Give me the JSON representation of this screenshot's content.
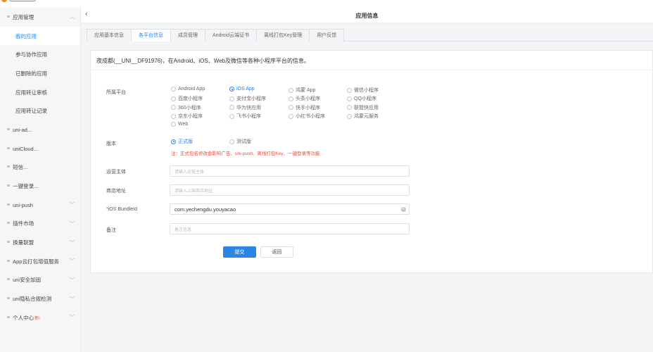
{
  "header": {
    "title": "应用信息"
  },
  "sidebar": {
    "items": [
      {
        "label": "应用管理",
        "type": "group",
        "chevron": "up"
      },
      {
        "label": "我的应用",
        "type": "sub",
        "active": true
      },
      {
        "label": "参与协作应用",
        "type": "sub"
      },
      {
        "label": "已删除的应用",
        "type": "sub"
      },
      {
        "label": "应用转让审核",
        "type": "sub"
      },
      {
        "label": "应用转让记录",
        "type": "sub"
      },
      {
        "label": "uni-ad...",
        "type": "group"
      },
      {
        "label": "uniCloud...",
        "type": "group"
      },
      {
        "label": "短信...",
        "type": "group"
      },
      {
        "label": "一键登录...",
        "type": "group"
      },
      {
        "label": "uni-push",
        "type": "group",
        "chevron": "down"
      },
      {
        "label": "插件市场",
        "type": "group",
        "chevron": "down"
      },
      {
        "label": "换量联盟",
        "type": "group",
        "chevron": "down"
      },
      {
        "label": "App云打包增值服务",
        "type": "group",
        "chevron": "down"
      },
      {
        "label": "uni安全加固",
        "type": "group",
        "chevron": "down"
      },
      {
        "label": "uni隐私合规检测",
        "type": "group",
        "chevron": "down"
      },
      {
        "label": "个人中心",
        "type": "group",
        "chevron": "down",
        "badge": "新!"
      }
    ]
  },
  "tabs": [
    "应用基本信息",
    "各平台信息",
    "成员管理",
    "Android云端证书",
    "离线打包Key管理",
    "用户反馈"
  ],
  "active_tab": "各平台信息",
  "form": {
    "description": "夜成都(__UNI__DF91976)，在Android、iOS、Web及微信等各种小程序平台的信息。",
    "platform_label": "所属平台",
    "platforms": [
      "Android App",
      "iOS App",
      "鸿蒙 App",
      "微信小程序",
      "百度小程序",
      "支付宝小程序",
      "头条小程序",
      "QQ小程序",
      "360小程序",
      "华为快应用",
      "快手小程序",
      "联盟快应用",
      "京东小程序",
      "飞书小程序",
      "小红书小程序",
      "鸿蒙元服务",
      "Web"
    ],
    "selected_platform": "iOS App",
    "version_label": "版本",
    "versions": [
      "正式版",
      "测试版"
    ],
    "selected_version": "正式版",
    "version_warning": "注：正式包名修改会影响广告、uni-push、离线打包Key、一键登录等功能",
    "operator_label": "运营主体",
    "operator_placeholder": "请输入运营主体",
    "store_label": "商店地址",
    "store_placeholder": "请输入上架商店地址",
    "bundle_label": "iOS BundleId",
    "bundle_required_mark": "*",
    "bundle_value": "com.yechengdu.youyacao",
    "remark_label": "备注",
    "remark_placeholder": "备注信息",
    "submit_label": "提交",
    "back_label": "返回"
  },
  "colors": {
    "accent": "#2b85e4",
    "warning": "#e74c3c",
    "sidebar_bg": "#f5f6f7"
  }
}
